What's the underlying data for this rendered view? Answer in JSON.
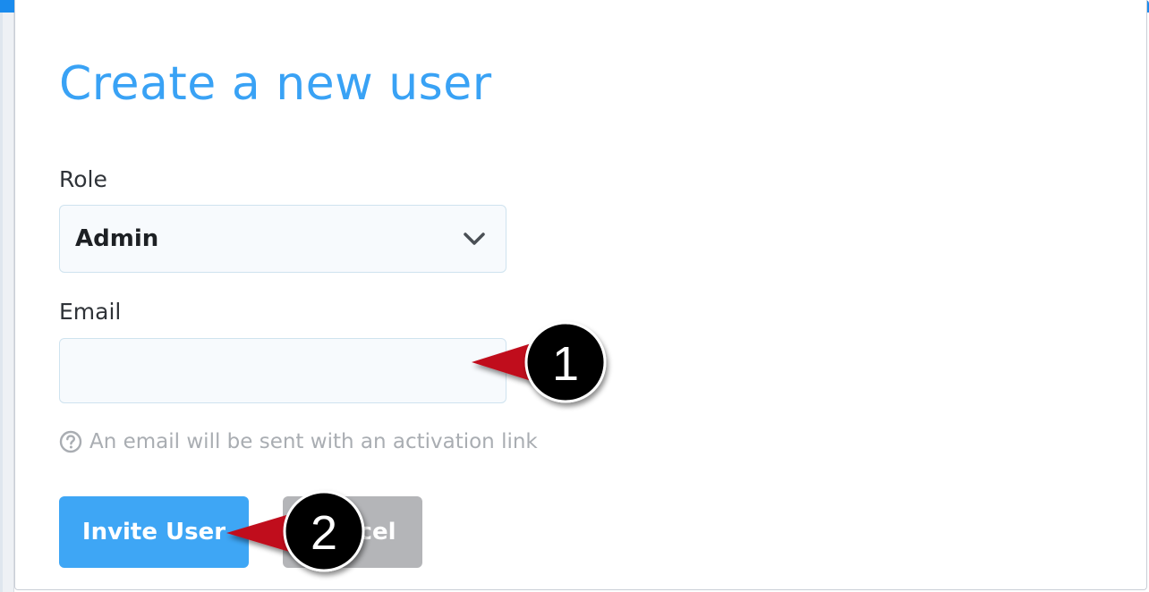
{
  "form": {
    "title": "Create a new user",
    "role_label": "Role",
    "role_value": "Admin",
    "email_label": "Email",
    "email_value": "",
    "email_placeholder": "",
    "help_text": "An email will be sent with an activation link",
    "invite_button": "Invite User",
    "cancel_button": "Cancel"
  },
  "annotations": [
    {
      "number": "1",
      "target": "email-input"
    },
    {
      "number": "2",
      "target": "invite-user-button"
    }
  ],
  "colors": {
    "accent": "#1a8bed",
    "title": "#39a2f5",
    "primary_button": "#3ea6f5",
    "secondary_button": "#b4b5b8",
    "callout_arrow": "#c0101d",
    "callout_badge": "#000000"
  },
  "icons": [
    "chevron-down-icon",
    "question-circle-icon"
  ]
}
